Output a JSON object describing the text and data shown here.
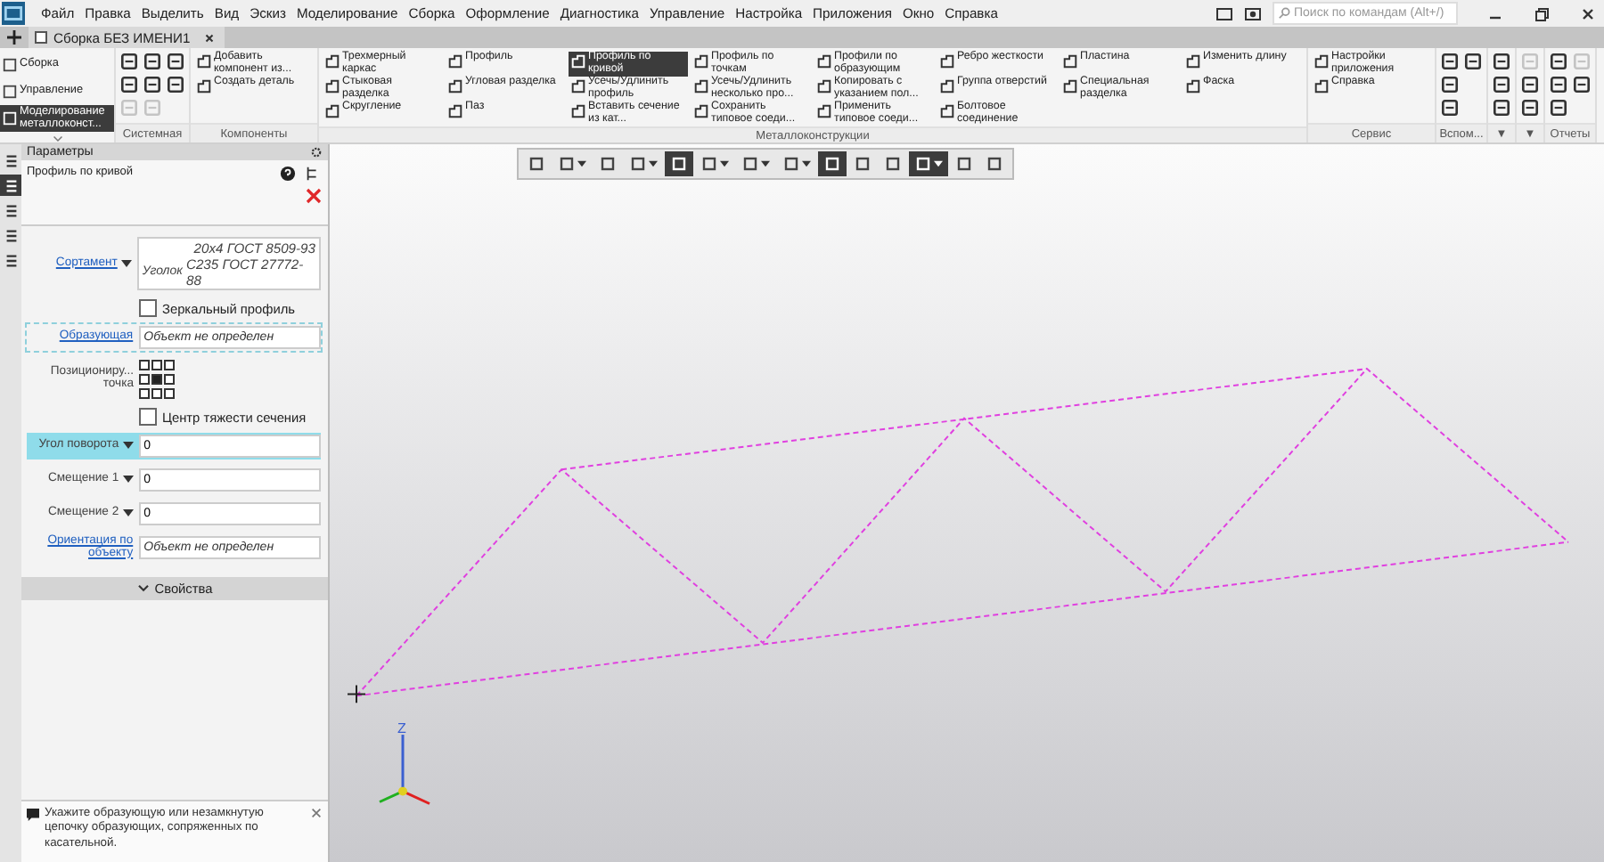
{
  "menu": [
    "Файл",
    "Правка",
    "Выделить",
    "Вид",
    "Эскиз",
    "Моделирование",
    "Сборка",
    "Оформление",
    "Диагностика",
    "Управление",
    "Настройка",
    "Приложения",
    "Окно",
    "Справка"
  ],
  "search": {
    "placeholder": "Поиск по командам (Alt+/)"
  },
  "tab": {
    "label": "Сборка БЕЗ ИМЕНИ1"
  },
  "sections": [
    {
      "label": "Сборка",
      "selected": false
    },
    {
      "label": "Управление",
      "selected": false
    },
    {
      "label": "Моделирование металлоконст...",
      "selected": true
    }
  ],
  "ribbon_groups": [
    {
      "label": "Системная",
      "kind": "icons",
      "items": [
        {
          "disabled": false
        },
        {
          "disabled": false
        },
        {
          "disabled": true
        },
        {
          "disabled": false
        },
        {
          "disabled": false
        },
        {
          "disabled": true
        },
        {
          "disabled": false
        },
        {
          "disabled": false
        }
      ]
    },
    {
      "label": "Компоненты",
      "kind": "columns",
      "columns": [
        [
          {
            "label": "Добавить компонент из...",
            "selected": false
          },
          {
            "label": "Создать деталь",
            "selected": false
          }
        ]
      ]
    },
    {
      "label": "Металлоконструкции",
      "kind": "columns",
      "columns": [
        [
          {
            "label": "Трехмерный каркас",
            "selected": false
          },
          {
            "label": "Стыковая разделка",
            "selected": false
          },
          {
            "label": "Скругление",
            "selected": false
          }
        ],
        [
          {
            "label": "Профиль",
            "selected": false
          },
          {
            "label": "Угловая разделка",
            "selected": false
          },
          {
            "label": "Паз",
            "selected": false
          }
        ],
        [
          {
            "label": "Профиль по кривой",
            "selected": true
          },
          {
            "label": "Усечь/Удлинить профиль",
            "selected": false
          },
          {
            "label": "Вставить сечение из кат...",
            "selected": false
          }
        ],
        [
          {
            "label": "Профиль по точкам",
            "selected": false
          },
          {
            "label": "Усечь/Удлинить несколько про...",
            "selected": false
          },
          {
            "label": "Сохранить типовое соеди...",
            "selected": false
          }
        ],
        [
          {
            "label": "Профили по образующим",
            "selected": false
          },
          {
            "label": "Копировать с указанием пол...",
            "selected": false
          },
          {
            "label": "Применить типовое соеди...",
            "selected": false
          }
        ],
        [
          {
            "label": "Ребро жесткости",
            "selected": false
          },
          {
            "label": "Группа отверстий",
            "selected": false
          },
          {
            "label": "Болтовое соединение",
            "selected": false
          }
        ],
        [
          {
            "label": "Пластина",
            "selected": false
          },
          {
            "label": "Специальная разделка",
            "selected": false
          }
        ],
        [
          {
            "label": "Изменить длину",
            "selected": false
          },
          {
            "label": "Фаска",
            "selected": false
          }
        ]
      ]
    },
    {
      "label": "Сервис",
      "kind": "columns",
      "columns": [
        [
          {
            "label": "Настройки приложения",
            "selected": false
          },
          {
            "label": "Справка",
            "selected": false
          }
        ]
      ]
    },
    {
      "label": "Вспом...",
      "kind": "icons",
      "items": [
        {
          "disabled": false
        },
        {
          "disabled": false
        },
        {
          "disabled": false
        },
        {
          "disabled": false
        }
      ]
    },
    {
      "label": "▼",
      "kind": "icons",
      "items": [
        {
          "disabled": false
        },
        {
          "disabled": false
        },
        {
          "disabled": false
        }
      ]
    },
    {
      "label": "▼",
      "kind": "icons",
      "items": [
        {
          "disabled": true
        },
        {
          "disabled": false
        },
        {
          "disabled": false
        }
      ]
    },
    {
      "label": "Отчеты",
      "kind": "icons",
      "items": [
        {
          "disabled": false
        },
        {
          "disabled": false
        },
        {
          "disabled": false
        },
        {
          "disabled": true
        },
        {
          "disabled": false
        }
      ]
    }
  ],
  "side_tabs": [
    {
      "selected": false
    },
    {
      "selected": true
    },
    {
      "selected": false
    },
    {
      "selected": false
    },
    {
      "selected": false
    }
  ],
  "panel": {
    "title": "Параметры",
    "subtitle": "Профиль по кривой",
    "sortament": {
      "label": "Сортамент",
      "type": "Уголок",
      "lines": [
        "20x4 ГОСТ 8509-93",
        "С235 ГОСТ 27772-88"
      ]
    },
    "mirror": {
      "label": "Зеркальный профиль",
      "checked": false
    },
    "generatrix": {
      "label": "Образующая",
      "placeholder": "Объект не определен",
      "highlighted": true
    },
    "position": {
      "label": "Позициониру... точка",
      "cells": [
        {
          "selected": false
        },
        {
          "selected": false
        },
        {
          "selected": false
        },
        {
          "selected": false
        },
        {
          "selected": true
        },
        {
          "selected": false
        },
        {
          "selected": false
        },
        {
          "selected": false
        },
        {
          "selected": false
        }
      ]
    },
    "center": {
      "label": "Центр тяжести сечения",
      "checked": false
    },
    "fields": [
      {
        "label": "Угол поворота",
        "value": "0",
        "highlighted": true
      },
      {
        "label": "Смещение 1",
        "value": "0",
        "highlighted": false
      },
      {
        "label": "Смещение 2",
        "value": "0",
        "highlighted": false
      }
    ],
    "orientation": {
      "label": "Ориентация по объекту",
      "placeholder": "Объект не определен"
    },
    "properties": {
      "label": "Свойства",
      "expanded": false
    },
    "hint": "Укажите образующую или незамкнутую цепочку образующих, сопряженных по касательной."
  },
  "view_toolbar": [
    {
      "selected": false,
      "dropdown": false
    },
    {
      "selected": false,
      "dropdown": true
    },
    {
      "selected": false,
      "dropdown": false
    },
    {
      "selected": false,
      "dropdown": true
    },
    {
      "selected": true,
      "dropdown": false
    },
    {
      "selected": false,
      "dropdown": true
    },
    {
      "selected": false,
      "dropdown": true
    },
    {
      "selected": false,
      "dropdown": true
    },
    {
      "selected": true,
      "dropdown": false
    },
    {
      "selected": false,
      "dropdown": false
    },
    {
      "selected": false,
      "dropdown": false
    },
    {
      "selected": true,
      "dropdown": true
    },
    {
      "selected": false,
      "dropdown": false
    },
    {
      "selected": false,
      "dropdown": false
    }
  ],
  "triad": {
    "label": "Z"
  }
}
